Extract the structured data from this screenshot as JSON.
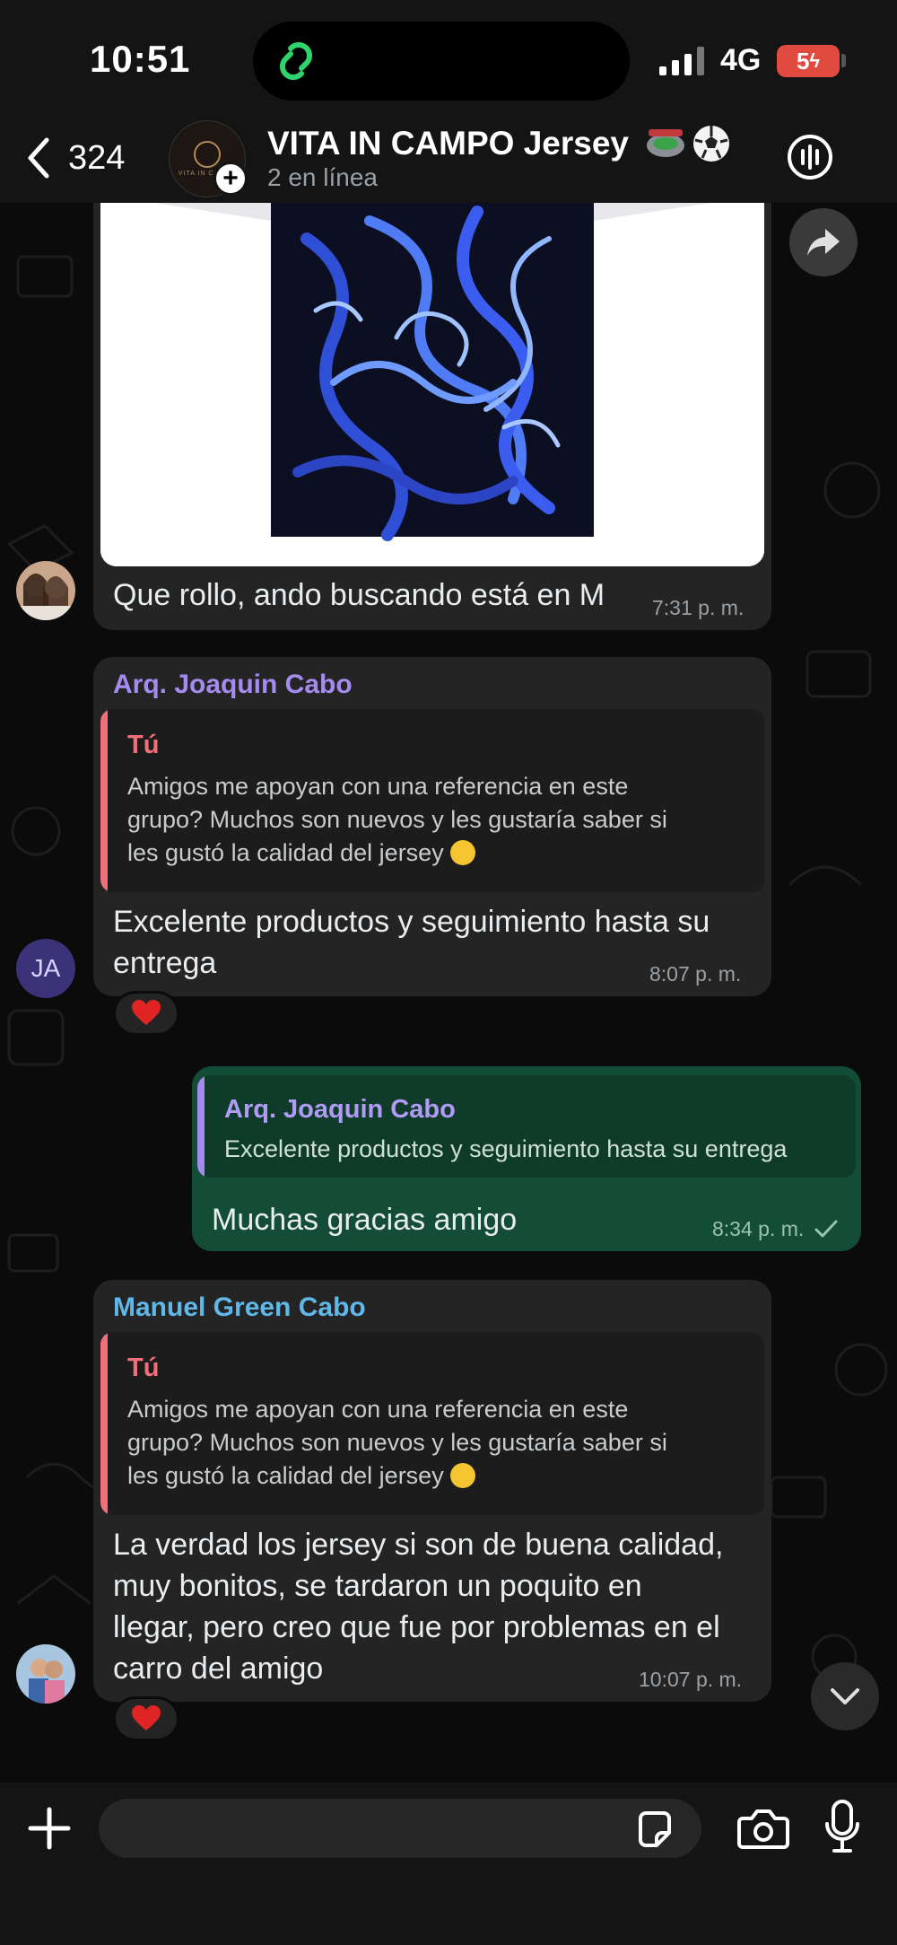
{
  "status_bar": {
    "time": "10:51",
    "network": "4G",
    "battery": "5"
  },
  "header": {
    "back_count": "324",
    "group_name": "VITA IN CAMPO Jersey",
    "online_status": "2 en línea",
    "avatar_text": "VITA IN CAMPO"
  },
  "messages": [
    {
      "type": "image",
      "caption": "Que rollo, ando buscando está en M",
      "time": "7:31 p. m."
    },
    {
      "type": "reply",
      "sender": "Arq. Joaquin Cabo",
      "sender_color": "#a48bf0",
      "avatar_initials": "JA",
      "quote": {
        "author": "Tú",
        "author_color": "#f06f7a",
        "bar_color": "#f06f7a",
        "lines": [
          "Amigos me apoyan con una referencia en este",
          "grupo? Muchos son nuevos y les gustaría saber si",
          "les gustó la calidad del jersey"
        ]
      },
      "lines": [
        "Excelente productos y seguimiento hasta su",
        "entrega"
      ],
      "time": "8:07 p. m.",
      "reaction": "heart"
    },
    {
      "type": "outgoing-reply",
      "quote": {
        "author": "Arq. Joaquin Cabo",
        "author_color": "#a48bf0",
        "bar_color": "#a48bf0",
        "text": "Excelente productos y seguimiento hasta su entrega"
      },
      "text": "Muchas gracias amigo",
      "time": "8:34 p. m.",
      "status": "sent"
    },
    {
      "type": "reply",
      "sender": "Manuel Green Cabo",
      "sender_color": "#5fb8e8",
      "quote": {
        "author": "Tú",
        "author_color": "#f06f7a",
        "bar_color": "#f06f7a",
        "lines": [
          "Amigos me apoyan con una referencia en este",
          "grupo? Muchos son nuevos y les gustaría saber si",
          "les gustó la calidad del jersey"
        ]
      },
      "lines": [
        "La verdad los jersey si son de buena calidad,",
        "muy bonitos, se tardaron un poquito en",
        "llegar, pero creo que fue por problemas en el",
        "carro del amigo"
      ],
      "time": "10:07 p. m.",
      "reaction": "heart"
    }
  ],
  "input": {
    "placeholder": ""
  },
  "icons": {
    "back": "chevron-left-icon",
    "call": "group-call-icon",
    "forward": "forward-icon",
    "scroll": "chevron-down-icon",
    "plus": "plus-icon",
    "sticker": "sticker-icon",
    "camera": "camera-icon",
    "mic": "microphone-icon"
  },
  "colors": {
    "incoming_bubble": "#242424",
    "outgoing_bubble": "#144d37",
    "background": "#0b0b0b"
  }
}
